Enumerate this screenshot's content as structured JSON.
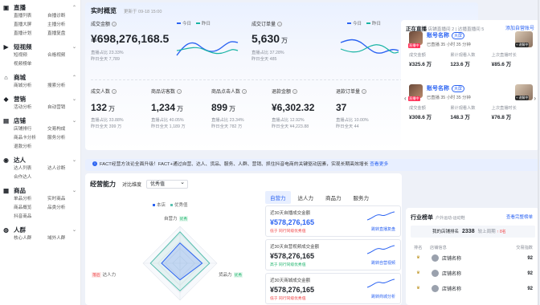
{
  "sidebar": {
    "sections": [
      {
        "title": "直播",
        "icon": "video-icon",
        "items": [
          "直播列表",
          "自播诊断",
          "直播大屏",
          "主播分析",
          "直播计划",
          "直播复盘"
        ],
        "expanded": true
      },
      {
        "title": "短视频",
        "icon": "play-icon",
        "items": [
          "短视频",
          "合格视频",
          "视频榜单"
        ],
        "expanded": false
      },
      {
        "title": "商城",
        "icon": "store-icon",
        "items": [
          "商城分析",
          "搜索分析"
        ],
        "expanded": true
      },
      {
        "title": "营销",
        "icon": "megaphone-icon",
        "items": [
          "活动分析",
          "自动营销"
        ],
        "expanded": false
      },
      {
        "title": "店铺",
        "icon": "shop-icon",
        "items": [
          "店铺排行",
          "交易构成",
          "商品卡分析",
          "服务分析",
          "退款分析"
        ],
        "expanded": false
      },
      {
        "title": "达人",
        "icon": "user-icon",
        "items": [
          "达人列表",
          "达人诊断",
          "合作达人"
        ],
        "expanded": false
      },
      {
        "title": "商品",
        "icon": "box-icon",
        "items": [
          "单品分析",
          "实时商品",
          "商品概览",
          "品类分析",
          "抖音商品"
        ],
        "expanded": false
      },
      {
        "title": "人群",
        "icon": "people-icon",
        "items": [
          "核心人群",
          "域外人群"
        ],
        "expanded": false
      }
    ]
  },
  "realtime": {
    "title": "实时概览",
    "updated": "更新于 09-18 15:00",
    "legend": {
      "today": "今日",
      "yesterday": "昨日"
    },
    "colors": {
      "today": "#2b63f2",
      "yesterday": "#18b4a4"
    },
    "gmv": {
      "label": "成交金额",
      "value": "¥698,276,168.5",
      "sub1": "直播占比 23.33%",
      "sub2": "昨日全天 7,789"
    },
    "orders": {
      "label": "成交订单量",
      "value": "5,630",
      "unit": "万",
      "sub1": "直播占比 37.28%",
      "sub2": "昨日全天 485"
    },
    "metrics": [
      {
        "label": "成交人数",
        "value": "132",
        "unit": "万",
        "sub1": "直播占比 33.88%",
        "sub2": "昨日全天 399 万"
      },
      {
        "label": "商品访客数",
        "value": "1,234",
        "unit": "万",
        "sub1": "直播占比 40.05%",
        "sub2": "昨日全天 1,189 万"
      },
      {
        "label": "商品点击人数",
        "value": "899",
        "unit": "万",
        "sub1": "直播占比 23.34%",
        "sub2": "昨日全天 782 万"
      },
      {
        "label": "退款金额",
        "value": "¥6,302.32",
        "unit": "",
        "sub1": "直播占比 12.92%",
        "sub2": "昨日全天 ¥4,223.88"
      },
      {
        "label": "退款订单量",
        "value": "37",
        "unit": "",
        "sub1": "直播占比 10.00%",
        "sub2": "昨日全天 44"
      }
    ]
  },
  "live": {
    "header": "正在直播",
    "sub": "店铺直播间 2 | 达播直播间 5",
    "add_link": "添加自营账号",
    "cards": [
      {
        "name": "账号名称",
        "badge": "大屏",
        "meta": "已直播 35 小时 35 分钟",
        "tag": "直播中",
        "thumb_tag": "+ 讲解中",
        "stats": [
          {
            "l": "成交金额",
            "v": "¥325.6 万"
          },
          {
            "l": "累计观看人数",
            "v": "123.6 万"
          },
          {
            "l": "上次直播时长",
            "v": "¥85.6 万"
          }
        ]
      },
      {
        "name": "账号名称",
        "badge": "大屏",
        "meta": "已直播 35 小时 35 分钟",
        "tag": "直播中",
        "thumb_tag": "+ 讲解中",
        "stats": [
          {
            "l": "成交金额",
            "v": "¥308.6 万"
          },
          {
            "l": "累计观看人数",
            "v": "148.3 万"
          },
          {
            "l": "上次直播时长",
            "v": "¥76.8 万"
          }
        ]
      }
    ]
  },
  "banner": {
    "text": "FACT经营方法论全面升级！FACT+通过自营、达人、货品、服务、人群、营销、抓住抖音电商的关键驱动因素，实现长期高效增长",
    "link": "查看更多"
  },
  "capability": {
    "title": "经营能力",
    "dim_label": "对比维度",
    "dim_value": "优秀值",
    "legend": {
      "mine": "本店",
      "good": "优秀值"
    },
    "axes": [
      {
        "name": "自营力",
        "tag": "优秀",
        "tag_type": "good"
      },
      {
        "name": "货品力",
        "tag": "优秀",
        "tag_type": "good"
      },
      {
        "name": "达人力",
        "tag": "落后",
        "tag_type": "bad"
      }
    ],
    "radar": {
      "mine": [
        0.55,
        0.6,
        0.45,
        0.5
      ],
      "good": [
        0.85,
        0.8,
        0.75,
        0.8
      ]
    },
    "tabs": [
      "自营力",
      "达人力",
      "商品力",
      "服务力"
    ],
    "active_tab": "自营力",
    "cards": [
      {
        "label": "近30天自播成交金额",
        "value": "¥578,276,165",
        "sub": "低于 同行同级优秀值",
        "link": "跳转直播复盘",
        "highlight": true
      },
      {
        "label": "近30天自营视频成交金额",
        "value": "¥578,276,165",
        "sub": "高于 同行同级优秀值",
        "link": "跳转自营视频",
        "highlight": false
      },
      {
        "label": "近30天商城成交金额",
        "value": "¥578,276,165",
        "sub": "低于 同行同级优秀值",
        "link": "跳转商城分析",
        "highlight": false
      }
    ]
  },
  "rank": {
    "title": "行业榜单",
    "category": "户外运动-运动鞋",
    "more": "查看完整榜单",
    "my_rank_label": "我的店铺排名",
    "my_rank": "2338",
    "rank_change_label": "较上周期",
    "rank_change": "↑ 8名",
    "cols": [
      "排名",
      "店铺信息",
      "交易指数"
    ],
    "rows": [
      {
        "rank": "1",
        "name": "店铺名称",
        "score": "92"
      },
      {
        "rank": "2",
        "name": "店铺名称",
        "score": "92"
      },
      {
        "rank": "3",
        "name": "店铺名称",
        "score": "92"
      }
    ]
  }
}
